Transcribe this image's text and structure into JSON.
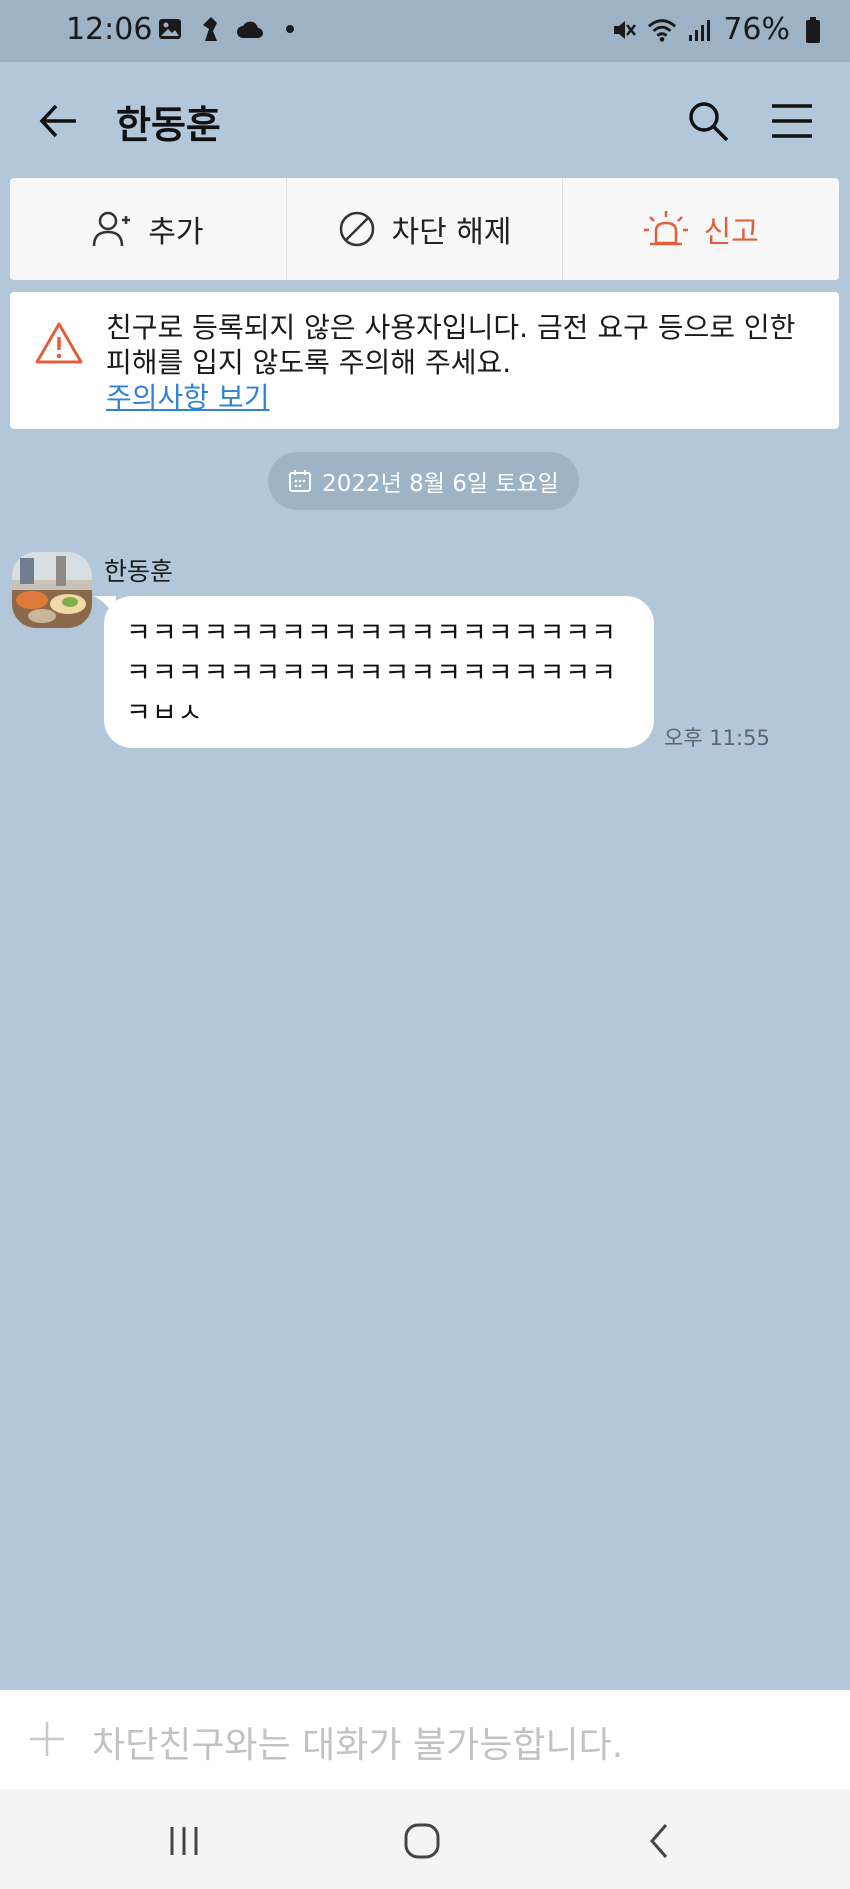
{
  "status_bar": {
    "time": "12:06",
    "battery": "76%",
    "left_icons": [
      "gallery-icon",
      "bird-app-icon",
      "cloud-icon",
      "dot-icon"
    ],
    "right_icons": [
      "mute-icon",
      "wifi-icon",
      "signal-icon",
      "battery-icon"
    ]
  },
  "header": {
    "title": "한동훈"
  },
  "actions": {
    "add_label": "추가",
    "unblock_label": "차단 해제",
    "report_label": "신고"
  },
  "warning": {
    "text": "친구로 등록되지 않은 사용자입니다. 금전 요구 등으로 인한 피해를 입지 않도록 주의해 주세요.",
    "link": "주의사항 보기"
  },
  "chat": {
    "date_label": "2022년 8월 6일 토요일",
    "messages": [
      {
        "sender": "한동훈",
        "text": "ㅋㅋㅋㅋㅋㅋㅋㅋㅋㅋㅋㅋㅋㅋㅋㅋㅋㅋㅋㅋㅋㅋㅋㅋㅋㅋㅋㅋㅋㅋㅋㅋㅋㅋㅋㅋㅋㅋㅋㅂㅅ",
        "time": "오후 11:55"
      }
    ]
  },
  "input": {
    "placeholder": "차단친구와는 대화가 불가능합니다."
  },
  "colors": {
    "chat_background": "#b2c7da",
    "report_accent": "#e0603a",
    "link": "#2f82d8"
  }
}
